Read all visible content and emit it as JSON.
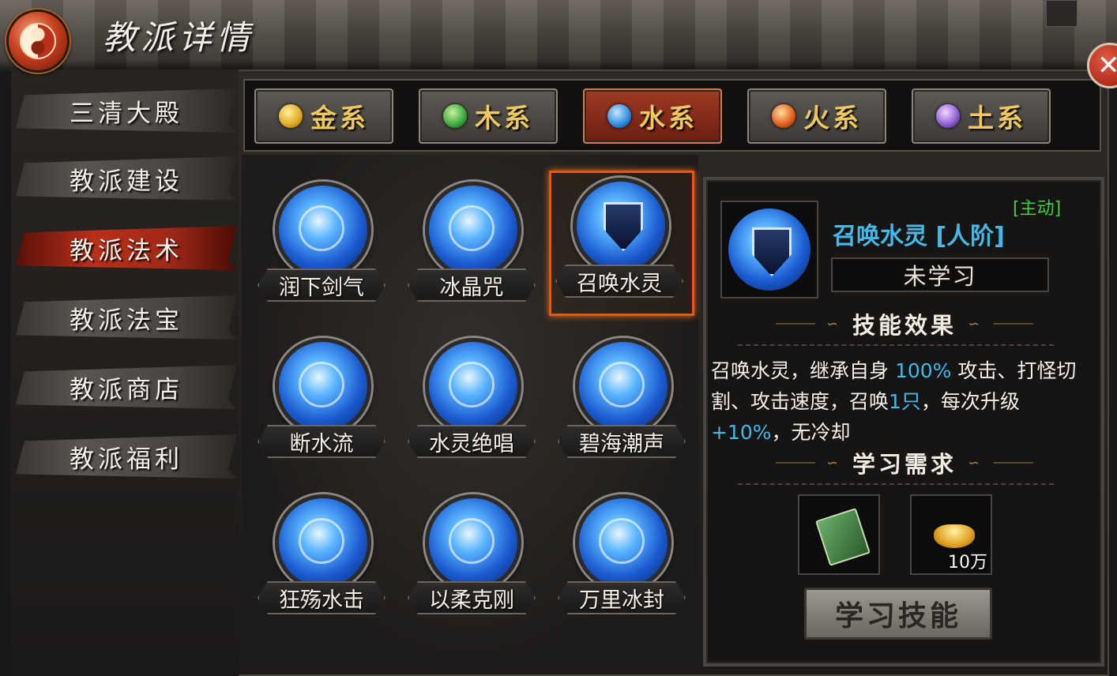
{
  "header": {
    "title": "教派详情"
  },
  "sidebar": {
    "items": [
      {
        "label": "三清大殿",
        "active": false
      },
      {
        "label": "教派建设",
        "active": false
      },
      {
        "label": "教派法术",
        "active": true
      },
      {
        "label": "教派法宝",
        "active": false
      },
      {
        "label": "教派商店",
        "active": false
      },
      {
        "label": "教派福利",
        "active": false
      }
    ]
  },
  "tabs": [
    {
      "label": "金系",
      "orb_color": "#e0a820",
      "active": false
    },
    {
      "label": "木系",
      "orb_color": "#3aa83a",
      "active": false
    },
    {
      "label": "水系",
      "orb_color": "#2a8ae0",
      "active": true
    },
    {
      "label": "火系",
      "orb_color": "#e05a18",
      "active": false
    },
    {
      "label": "土系",
      "orb_color": "#8a5ad0",
      "active": false
    }
  ],
  "skills": [
    {
      "name": "润下剑气",
      "selected": false
    },
    {
      "name": "冰晶咒",
      "selected": false
    },
    {
      "name": "召唤水灵",
      "selected": true
    },
    {
      "name": "断水流",
      "selected": false
    },
    {
      "name": "水灵绝唱",
      "selected": false
    },
    {
      "name": "碧海潮声",
      "selected": false
    },
    {
      "name": "狂殇水击",
      "selected": false
    },
    {
      "name": "以柔克刚",
      "selected": false
    },
    {
      "name": "万里冰封",
      "selected": false
    }
  ],
  "detail": {
    "badge": "[主动]",
    "name": "召唤水灵 [人阶]",
    "status": "未学习",
    "effect_title": "技能效果",
    "description": {
      "p1": "召唤水灵，继承自身",
      "v1": "100%",
      "p2": "攻击、打怪切割、攻击速度，召唤",
      "v2": "1只",
      "p3": "，每次升级",
      "v3": "+10%",
      "p4": "，无冷却"
    },
    "requirement_title": "学习需求",
    "requirements": [
      {
        "item": "skill-book",
        "amount": ""
      },
      {
        "item": "gold-ingot",
        "amount": "10万"
      }
    ],
    "learn_button": "学习技能"
  },
  "colors": {
    "accent_blue": "#44b8e8",
    "active_red": "#b8301a",
    "tab_text_gold": "#f0c860",
    "badge_green": "#3ad43a"
  }
}
